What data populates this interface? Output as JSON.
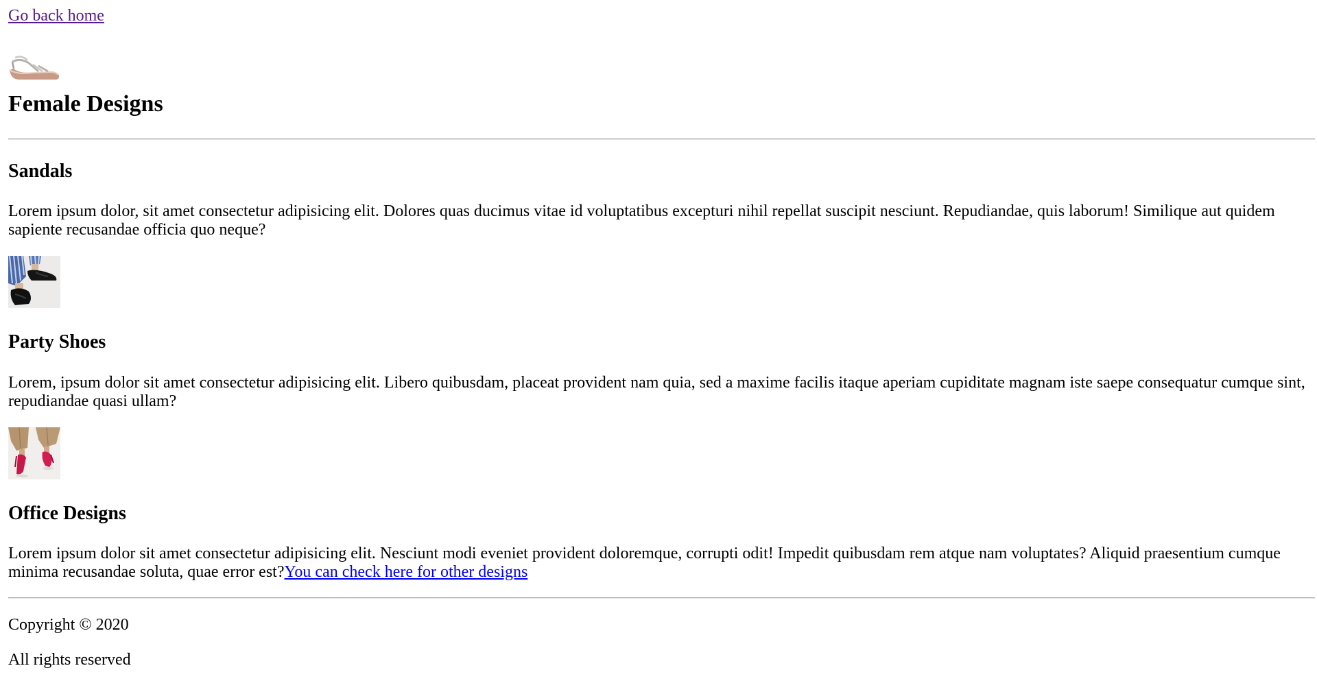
{
  "nav": {
    "back_link": "Go back home"
  },
  "header": {
    "logo_icon": "wedge-sandal-icon",
    "title": "Female Designs"
  },
  "sections": [
    {
      "heading": "Sandals",
      "text": "Lorem ipsum dolor, sit amet consectetur adipisicing elit. Dolores quas ducimus vitae id voluptatibus excepturi nihil repellat suscipit nesciunt. Repudiandae, quis laborum! Similique aut quidem sapiente recusandae officia quo neque?",
      "image_icon": "black-slide-sandals-image"
    },
    {
      "heading": "Party Shoes",
      "text": "Lorem, ipsum dolor sit amet consectetur adipisicing elit. Libero quibusdam, placeat provident nam quia, sed a maxime facilis itaque aperiam cupiditate magnam iste saepe consequatur cumque sint, repudiandae quasi ullam?",
      "image_icon": "red-heels-image"
    },
    {
      "heading": "Office Designs",
      "text": "Lorem ipsum dolor sit amet consectetur adipisicing elit. Nesciunt modi eveniet provident doloremque, corrupti odit! Impedit quibusdam rem atque nam voluptates? Aliquid praesentium cumque minima recusandae soluta, quae error est?",
      "link": "You can check here for other designs"
    }
  ],
  "footer": {
    "copyright": "Copyright © 2020",
    "rights": "All rights reserved"
  },
  "colors": {
    "visited_link": "#551a8b",
    "link": "#0000ee",
    "text": "#000000",
    "rule": "#9b9b9b"
  }
}
